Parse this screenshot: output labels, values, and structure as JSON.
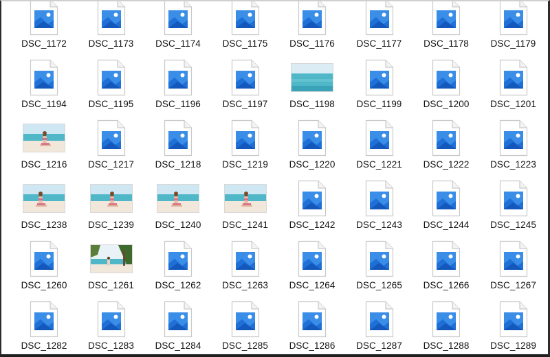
{
  "window": {
    "view": "large-icons"
  },
  "icon_names": {
    "generic": "image-file-icon",
    "photo": "photo-thumbnail"
  },
  "colors": {
    "icon_blue_dark": "#1e6fd6",
    "icon_blue_mid": "#3a8ee8",
    "icon_blue_light": "#7cc1f5",
    "page_border": "#c9c9c9",
    "sea": "#4fb7c8",
    "sky": "#cfe6f3",
    "sand": "#f1e7da"
  },
  "files": [
    {
      "name": "DSC_1172",
      "thumb": "icon"
    },
    {
      "name": "DSC_1173",
      "thumb": "icon"
    },
    {
      "name": "DSC_1174",
      "thumb": "icon"
    },
    {
      "name": "DSC_1175",
      "thumb": "icon"
    },
    {
      "name": "DSC_1176",
      "thumb": "icon"
    },
    {
      "name": "DSC_1177",
      "thumb": "icon"
    },
    {
      "name": "DSC_1178",
      "thumb": "icon"
    },
    {
      "name": "DSC_1179",
      "thumb": "icon"
    },
    {
      "name": "DSC_1194",
      "thumb": "icon"
    },
    {
      "name": "DSC_1195",
      "thumb": "icon"
    },
    {
      "name": "DSC_1196",
      "thumb": "icon"
    },
    {
      "name": "DSC_1197",
      "thumb": "icon"
    },
    {
      "name": "DSC_1198",
      "thumb": "sea"
    },
    {
      "name": "DSC_1199",
      "thumb": "icon"
    },
    {
      "name": "DSC_1200",
      "thumb": "icon"
    },
    {
      "name": "DSC_1201",
      "thumb": "icon"
    },
    {
      "name": "DSC_1216",
      "thumb": "beach"
    },
    {
      "name": "DSC_1217",
      "thumb": "icon"
    },
    {
      "name": "DSC_1218",
      "thumb": "icon"
    },
    {
      "name": "DSC_1219",
      "thumb": "icon"
    },
    {
      "name": "DSC_1220",
      "thumb": "icon"
    },
    {
      "name": "DSC_1221",
      "thumb": "icon"
    },
    {
      "name": "DSC_1222",
      "thumb": "icon"
    },
    {
      "name": "DSC_1223",
      "thumb": "icon"
    },
    {
      "name": "DSC_1238",
      "thumb": "beach"
    },
    {
      "name": "DSC_1239",
      "thumb": "beach"
    },
    {
      "name": "DSC_1240",
      "thumb": "beach"
    },
    {
      "name": "DSC_1241",
      "thumb": "beach"
    },
    {
      "name": "DSC_1242",
      "thumb": "icon"
    },
    {
      "name": "DSC_1243",
      "thumb": "icon"
    },
    {
      "name": "DSC_1244",
      "thumb": "icon"
    },
    {
      "name": "DSC_1245",
      "thumb": "icon"
    },
    {
      "name": "DSC_1260",
      "thumb": "icon"
    },
    {
      "name": "DSC_1261",
      "thumb": "palm"
    },
    {
      "name": "DSC_1262",
      "thumb": "icon"
    },
    {
      "name": "DSC_1263",
      "thumb": "icon"
    },
    {
      "name": "DSC_1264",
      "thumb": "icon"
    },
    {
      "name": "DSC_1265",
      "thumb": "icon"
    },
    {
      "name": "DSC_1266",
      "thumb": "icon"
    },
    {
      "name": "DSC_1267",
      "thumb": "icon"
    },
    {
      "name": "DSC_1282",
      "thumb": "icon"
    },
    {
      "name": "DSC_1283",
      "thumb": "icon"
    },
    {
      "name": "DSC_1284",
      "thumb": "icon"
    },
    {
      "name": "DSC_1285",
      "thumb": "icon"
    },
    {
      "name": "DSC_1286",
      "thumb": "icon"
    },
    {
      "name": "DSC_1287",
      "thumb": "icon"
    },
    {
      "name": "DSC_1288",
      "thumb": "icon"
    },
    {
      "name": "DSC_1289",
      "thumb": "icon"
    }
  ]
}
